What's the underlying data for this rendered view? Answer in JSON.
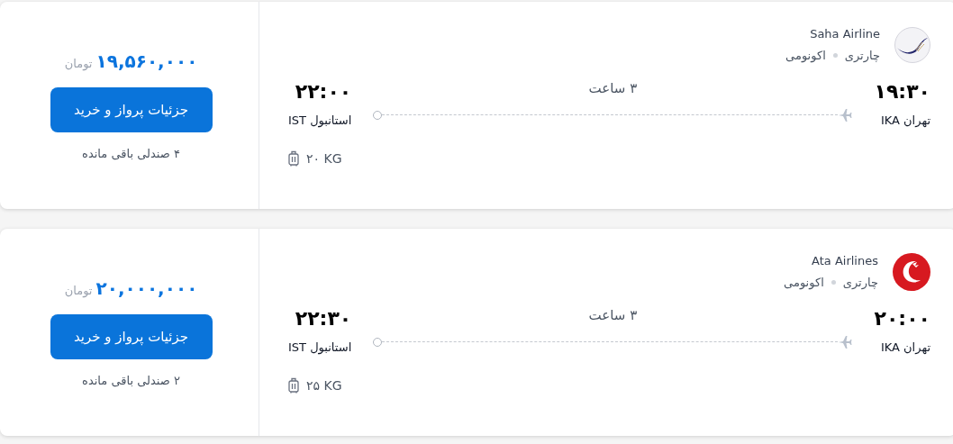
{
  "flights": [
    {
      "airline": "Saha Airline",
      "kind": "swoosh",
      "tags": [
        "چارتری",
        "اکونومی"
      ],
      "departure": {
        "time": "۱۹:۳۰",
        "city": "تهران IKA"
      },
      "arrival": {
        "time": "۲۲:۰۰",
        "city": "استانبول IST"
      },
      "duration": "۳ ساعت",
      "baggage": "۲۰ KG",
      "price": "۱۹,۵۶۰,۰۰۰",
      "currency": "تومان",
      "button": "جزئیات پرواز و خرید",
      "seats": "۴ صندلی باقی مانده"
    },
    {
      "airline": "Ata Airlines",
      "kind": "crescent",
      "tags": [
        "چارتری",
        "اکونومی"
      ],
      "departure": {
        "time": "۲۰:۰۰",
        "city": "تهران IKA"
      },
      "arrival": {
        "time": "۲۲:۳۰",
        "city": "استانبول IST"
      },
      "duration": "۳ ساعت",
      "baggage": "۲۵ KG",
      "price": "۲۰,۰۰۰,۰۰۰",
      "currency": "تومان",
      "button": "جزئیات پرواز و خرید",
      "seats": "۲ صندلی باقی مانده"
    }
  ]
}
